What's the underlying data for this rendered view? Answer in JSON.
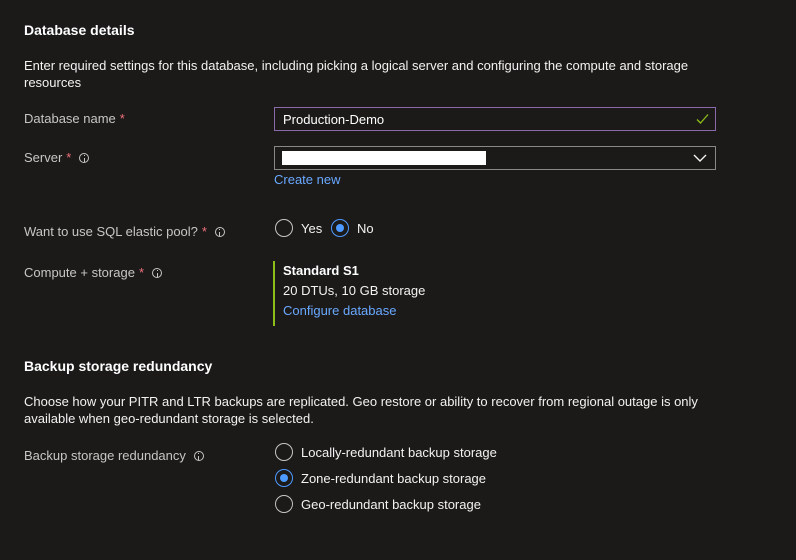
{
  "database_details": {
    "heading": "Database details",
    "description": "Enter required settings for this database, including picking a logical server and configuring the compute and storage resources",
    "database_name": {
      "label": "Database name",
      "required": "*",
      "value": "Production-Demo"
    },
    "server": {
      "label": "Server",
      "required": "*",
      "value": "",
      "create_new": "Create new"
    },
    "elastic_pool": {
      "label": "Want to use SQL elastic pool?",
      "required": "*",
      "options": [
        "Yes",
        "No"
      ],
      "selected": "No"
    },
    "compute_storage": {
      "label": "Compute + storage",
      "required": "*",
      "tier": "Standard S1",
      "details": "20 DTUs, 10 GB storage",
      "configure": "Configure database"
    }
  },
  "backup": {
    "heading": "Backup storage redundancy",
    "description": "Choose how your PITR and LTR backups are replicated. Geo restore or ability to recover from regional outage is only available when geo-redundant storage is selected.",
    "label": "Backup storage redundancy",
    "options": [
      "Locally-redundant backup storage",
      "Zone-redundant backup storage",
      "Geo-redundant backup storage"
    ],
    "selected": "Zone-redundant backup storage"
  },
  "colors": {
    "accent": "#4c9aff",
    "required": "#f1707b",
    "valid": "#8cbd18"
  }
}
